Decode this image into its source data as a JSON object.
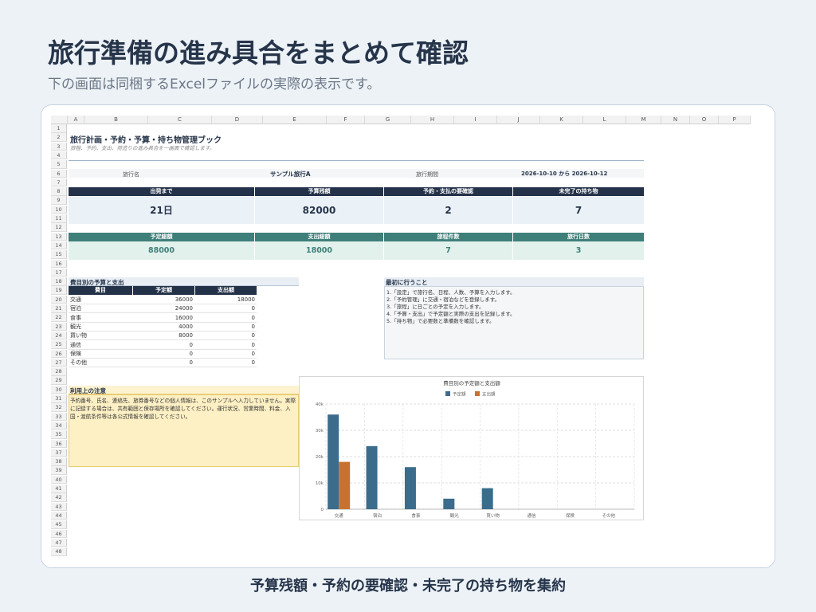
{
  "page": {
    "title": "旅行準備の進み具合をまとめて確認",
    "subtitle": "下の画面は同梱するExcelファイルの実際の表示です。",
    "caption": "予算残額・予約の要確認・未完了の持ち物を集約"
  },
  "sheet": {
    "columns": [
      "A",
      "B",
      "C",
      "D",
      "E",
      "F",
      "G",
      "H",
      "I",
      "J",
      "K",
      "L",
      "M",
      "N",
      "O",
      "P"
    ],
    "rows": [
      "1",
      "2",
      "3",
      "4",
      "5",
      "6",
      "7",
      "8",
      "9",
      "10",
      "11",
      "12",
      "13",
      "14",
      "15",
      "16",
      "17",
      "18",
      "19",
      "20",
      "21",
      "22",
      "23",
      "24",
      "25",
      "26",
      "27",
      "28",
      "29",
      "30",
      "31",
      "32",
      "33",
      "34",
      "35",
      "36",
      "37",
      "38",
      "39",
      "40",
      "41",
      "42",
      "43",
      "44",
      "45",
      "46",
      "47",
      "48"
    ],
    "title": "旅行計画・予約・予算・持ち物管理ブック",
    "subtitle": "旅程、予約、支出、荷造りの進み具合を一画面で確認します。",
    "trip_name_label": "旅行名",
    "trip_name": "サンプル旅行A",
    "period_label": "旅行期間",
    "period": "2026-10-10 から 2026-10-12",
    "kpi1": [
      {
        "label": "出発まで",
        "value": "21日"
      },
      {
        "label": "予算残額",
        "value": "82000"
      },
      {
        "label": "予約・支払の要確認",
        "value": "2"
      },
      {
        "label": "未完了の持ち物",
        "value": "7"
      }
    ],
    "kpi2": [
      {
        "label": "予定総額",
        "value": "88000"
      },
      {
        "label": "支出総額",
        "value": "18000"
      },
      {
        "label": "旅程件数",
        "value": "7"
      },
      {
        "label": "旅行日数",
        "value": "3"
      }
    ],
    "expense_section": "費目別の予算と支出",
    "expense_headers": [
      "費目",
      "予定額",
      "支出額"
    ],
    "expense_rows": [
      [
        "交通",
        "36000",
        "18000"
      ],
      [
        "宿泊",
        "24000",
        "0"
      ],
      [
        "食事",
        "16000",
        "0"
      ],
      [
        "観光",
        "4000",
        "0"
      ],
      [
        "買い物",
        "8000",
        "0"
      ],
      [
        "通信",
        "0",
        "0"
      ],
      [
        "保険",
        "0",
        "0"
      ],
      [
        "その他",
        "0",
        "0"
      ]
    ],
    "first_steps_title": "最初に行うこと",
    "first_steps": [
      "1.「設定」で旅行名、日程、人数、予算を入力します。",
      "2.「予約管理」に交通・宿泊などを登録します。",
      "3.「旅程」に日ごとの予定を入力します。",
      "4.「予算・支出」で予定額と実際の支出を記録します。",
      "5.「持ち物」で必要数と準備数を確認します。"
    ],
    "notice_title": "利用上の注意",
    "notice_lines": [
      "予約番号、氏名、連絡先、旅券番号などの個人情報は、このサンプルへ入力していません。実際",
      "に記録する場合は、共有範囲と保存場所を確認してください。運行状況、営業時間、料金、入",
      "国・渡航条件等は各公式情報を確認してください。"
    ]
  },
  "chart_data": {
    "type": "bar",
    "title": "費目別の予定額と支出額",
    "categories": [
      "交通",
      "宿泊",
      "食事",
      "観光",
      "買い物",
      "通信",
      "保険",
      "その他"
    ],
    "series": [
      {
        "name": "予定額",
        "values": [
          36000,
          24000,
          16000,
          4000,
          8000,
          0,
          0,
          0
        ],
        "color": "#3c6c8c"
      },
      {
        "name": "支出額",
        "values": [
          18000,
          0,
          0,
          0,
          0,
          0,
          0,
          0
        ],
        "color": "#c77230"
      }
    ],
    "ylim": [
      0,
      40000
    ],
    "yticks": [
      "0",
      "10k",
      "20k",
      "30k",
      "40k"
    ],
    "legend": "top"
  }
}
